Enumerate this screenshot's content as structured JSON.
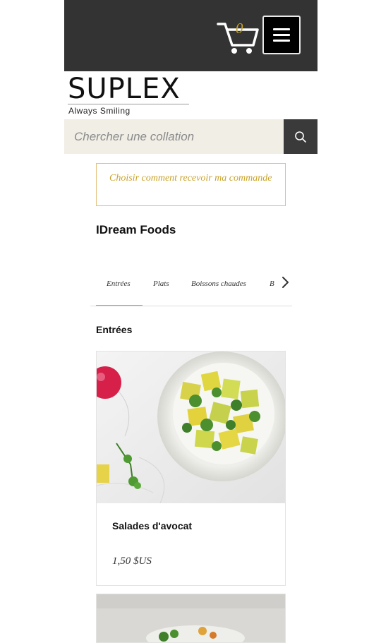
{
  "header": {
    "cart_count": "0",
    "cart_icon": "shopping-cart-icon",
    "menu_icon": "hamburger-menu-icon",
    "bg_color": "#333333",
    "accent_color": "#c9a227"
  },
  "brand": {
    "name": "SUPLEX",
    "tagline": "Always Smiling"
  },
  "search": {
    "placeholder": "Chercher une collation",
    "button_icon": "search-icon"
  },
  "delivery": {
    "label": "Choisir comment recevoir ma commande"
  },
  "restaurant": {
    "name": "IDream Foods"
  },
  "tabs": {
    "items": [
      {
        "label": "Entrées",
        "active": true
      },
      {
        "label": "Plats",
        "active": false
      },
      {
        "label": "Boissons chaudes",
        "active": false
      },
      {
        "label": "B",
        "active": false
      }
    ],
    "next_icon": "chevron-right-icon"
  },
  "section": {
    "title": "Entrées"
  },
  "items": [
    {
      "name": "Salades d'avocat",
      "price": "1,50 $US"
    }
  ]
}
